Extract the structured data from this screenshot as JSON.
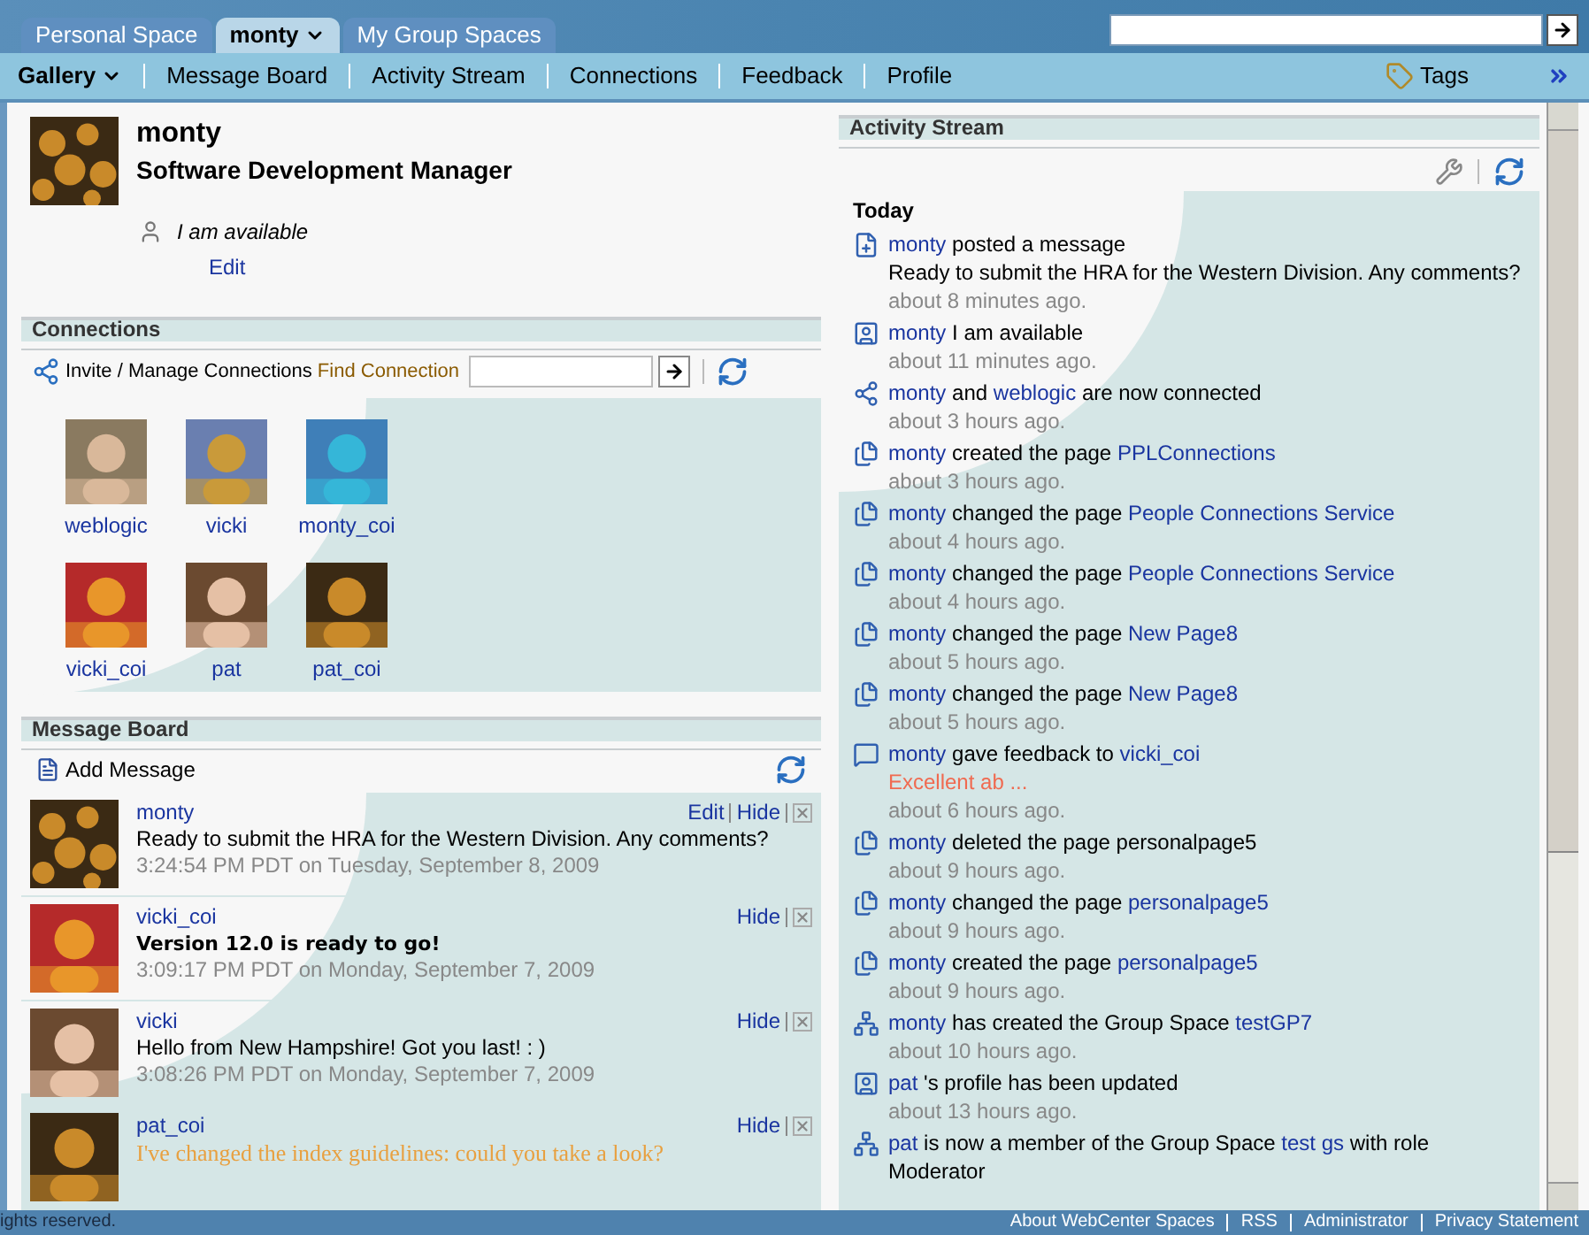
{
  "tabs": [
    {
      "label": "Personal Space",
      "selected": false,
      "menu": false
    },
    {
      "label": "monty",
      "selected": true,
      "menu": true
    },
    {
      "label": "My Group Spaces",
      "selected": false,
      "menu": false
    }
  ],
  "nav": {
    "items": [
      {
        "label": "Gallery",
        "kind": "menu"
      },
      {
        "label": "Message Board",
        "kind": "link"
      },
      {
        "label": "Activity Stream",
        "kind": "link"
      },
      {
        "label": "Connections",
        "kind": "link"
      },
      {
        "label": "Feedback",
        "kind": "link"
      },
      {
        "label": "Profile",
        "kind": "link"
      }
    ],
    "tags": "Tags"
  },
  "profile": {
    "name": "monty",
    "title": "Software Development Manager",
    "status": "I am available",
    "edit": "Edit"
  },
  "connections": {
    "title": "Connections",
    "invite": "Invite / Manage Connections",
    "find_label": "Find Connection",
    "people": [
      {
        "name": "weblogic"
      },
      {
        "name": "vicki"
      },
      {
        "name": "monty_coi"
      },
      {
        "name": "vicki_coi"
      },
      {
        "name": "pat"
      },
      {
        "name": "pat_coi"
      }
    ]
  },
  "message_board": {
    "title": "Message Board",
    "add": "Add Message",
    "messages": [
      {
        "author": "monty",
        "text": "Ready to submit the HRA for the Western Division.  Any comments?",
        "kind": "plain",
        "time": "3:24:54 PM PDT on Tuesday, September 8, 2009",
        "actions": [
          "Edit",
          "Hide"
        ]
      },
      {
        "author": "vicki_coi",
        "text": "Version 12.0 is ready to go!",
        "kind": "bold",
        "time": "3:09:17 PM PDT on Monday, September 7, 2009",
        "actions": [
          "Hide"
        ]
      },
      {
        "author": "vicki",
        "text": "Hello from New Hampshire! Got you last! : )",
        "kind": "plain",
        "time": "3:08:26 PM PDT on Monday, September 7, 2009",
        "actions": [
          "Hide"
        ]
      },
      {
        "author": "pat_coi",
        "text": "I've changed the index guidelines: could you take a look?",
        "kind": "highlight",
        "actions": [
          "Hide"
        ]
      }
    ]
  },
  "activity": {
    "title": "Activity Stream",
    "day": "Today",
    "items": [
      {
        "kind": "message",
        "segments": [
          {
            "text": "monty",
            "link": true
          },
          {
            "text": "posted a message",
            "link": false
          }
        ],
        "detail": "Ready to submit the HRA for the Western Division.  Any comments?",
        "time": "about 8 minutes ago."
      },
      {
        "kind": "status",
        "segments": [
          {
            "text": "monty",
            "link": true
          },
          {
            "text": "I am available",
            "link": false
          }
        ],
        "time": "about 11 minutes ago."
      },
      {
        "kind": "connection",
        "segments": [
          {
            "text": "monty",
            "link": true
          },
          {
            "text": "and",
            "link": false
          },
          {
            "text": "weblogic",
            "link": true
          },
          {
            "text": "are now connected",
            "link": false
          }
        ],
        "time": "about 3 hours ago."
      },
      {
        "kind": "page",
        "segments": [
          {
            "text": "monty",
            "link": true
          },
          {
            "text": "created the page",
            "link": false
          },
          {
            "text": "PPLConnections",
            "link": true
          }
        ],
        "time": "about 3 hours ago."
      },
      {
        "kind": "page",
        "segments": [
          {
            "text": "monty",
            "link": true
          },
          {
            "text": "changed the page",
            "link": false
          },
          {
            "text": "People Connections Service",
            "link": true
          }
        ],
        "time": "about 4 hours ago."
      },
      {
        "kind": "page",
        "segments": [
          {
            "text": "monty",
            "link": true
          },
          {
            "text": "changed the page",
            "link": false
          },
          {
            "text": "People Connections Service",
            "link": true
          }
        ],
        "time": "about 4 hours ago."
      },
      {
        "kind": "page",
        "segments": [
          {
            "text": "monty",
            "link": true
          },
          {
            "text": "changed the page",
            "link": false
          },
          {
            "text": "New Page8",
            "link": true
          }
        ],
        "time": "about 5 hours ago."
      },
      {
        "kind": "page",
        "segments": [
          {
            "text": "monty",
            "link": true
          },
          {
            "text": "changed the page",
            "link": false
          },
          {
            "text": "New Page8",
            "link": true
          }
        ],
        "time": "about 5 hours ago."
      },
      {
        "kind": "feedback",
        "segments": [
          {
            "text": "monty",
            "link": true
          },
          {
            "text": "gave feedback to",
            "link": false
          },
          {
            "text": "vicki_coi",
            "link": true
          }
        ],
        "note": "Excellent ab ...",
        "time": "about 6 hours ago."
      },
      {
        "kind": "page",
        "segments": [
          {
            "text": "monty",
            "link": true
          },
          {
            "text": "deleted the page",
            "link": false
          },
          {
            "text": "personalpage5",
            "link": false
          }
        ],
        "time": "about 9 hours ago."
      },
      {
        "kind": "page",
        "segments": [
          {
            "text": "monty",
            "link": true
          },
          {
            "text": "changed the page",
            "link": false
          },
          {
            "text": "personalpage5",
            "link": true
          }
        ],
        "time": "about 9 hours ago."
      },
      {
        "kind": "page",
        "segments": [
          {
            "text": "monty",
            "link": true
          },
          {
            "text": "created the page",
            "link": false
          },
          {
            "text": "personalpage5",
            "link": true
          }
        ],
        "time": "about 9 hours ago."
      },
      {
        "kind": "group",
        "segments": [
          {
            "text": "monty",
            "link": true
          },
          {
            "text": "has created the Group Space",
            "link": false
          },
          {
            "text": "testGP7",
            "link": true
          }
        ],
        "time": "about 10 hours ago."
      },
      {
        "kind": "profile",
        "segments": [
          {
            "text": "pat",
            "link": true
          },
          {
            "text": "'s profile has been updated",
            "link": false
          }
        ],
        "time": "about 13 hours ago."
      },
      {
        "kind": "group",
        "segments": [
          {
            "text": "pat",
            "link": true
          },
          {
            "text": "is now a member of the Group Space",
            "link": false
          },
          {
            "text": "test gs",
            "link": true
          },
          {
            "text": "with role",
            "link": false
          },
          {
            "text": "Moderator",
            "link": false
          }
        ]
      }
    ]
  },
  "footer": {
    "copyright": "ights reserved.",
    "links": [
      "About WebCenter Spaces",
      "RSS",
      "Administrator",
      "Privacy Statement"
    ]
  }
}
